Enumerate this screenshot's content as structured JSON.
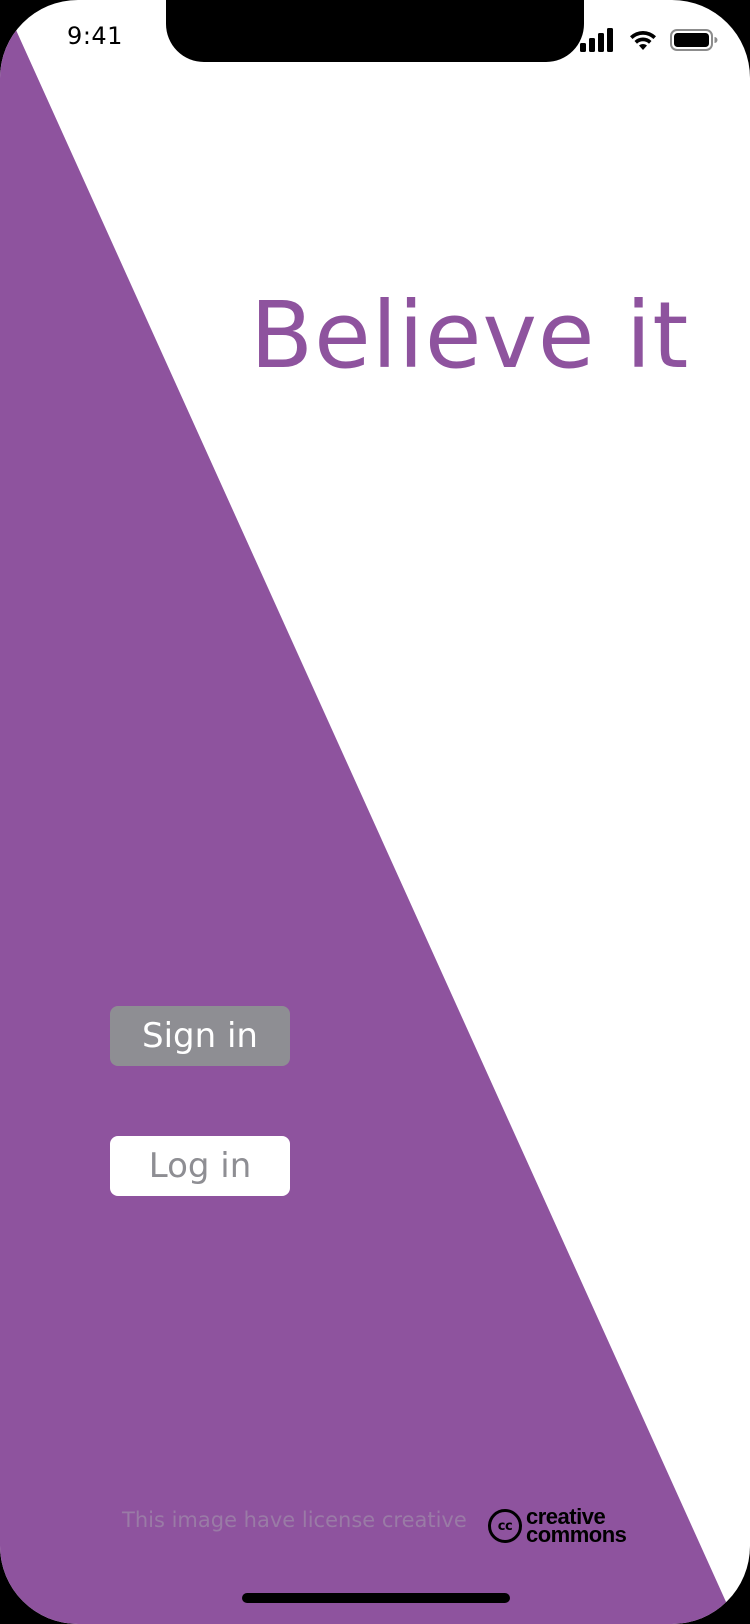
{
  "status_bar": {
    "time": "9:41",
    "icons": [
      "cellular-signal-icon",
      "wifi-icon",
      "battery-icon"
    ]
  },
  "app": {
    "title": "Believe it"
  },
  "buttons": {
    "sign_in_label": "Sign in",
    "log_in_label": "Log in"
  },
  "footer": {
    "license_text": "This image have license creative",
    "cc_badge": "cc",
    "cc_word_top": "creative",
    "cc_word_bottom": "commons"
  },
  "colors": {
    "accent_purple": "#8e539e",
    "background_white": "#ffffff",
    "button_gray": "#8e8e93",
    "frame_black": "#000000"
  }
}
